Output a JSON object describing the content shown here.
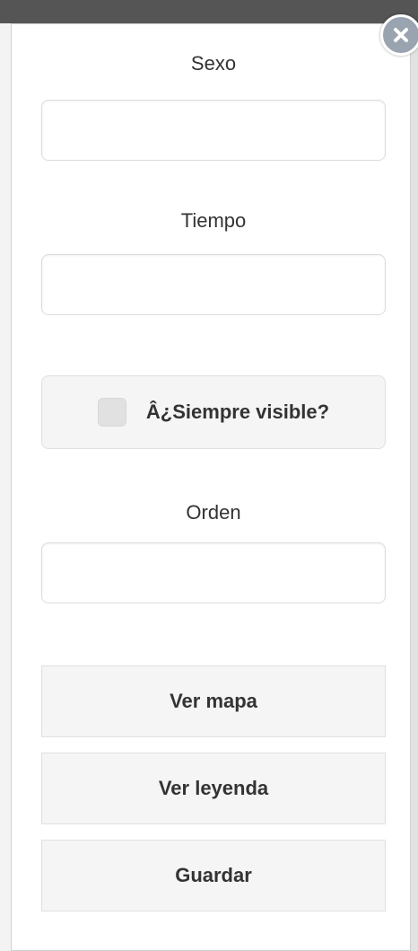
{
  "form": {
    "sexo": {
      "label": "Sexo",
      "value": ""
    },
    "tiempo": {
      "label": "Tiempo",
      "value": ""
    },
    "siempre_visible": {
      "label": "Â¿Siempre visible?",
      "checked": false
    },
    "orden": {
      "label": "Orden",
      "value": ""
    }
  },
  "buttons": {
    "ver_mapa": "Ver mapa",
    "ver_leyenda": "Ver leyenda",
    "guardar": "Guardar"
  },
  "close": {
    "icon": "close-icon"
  }
}
